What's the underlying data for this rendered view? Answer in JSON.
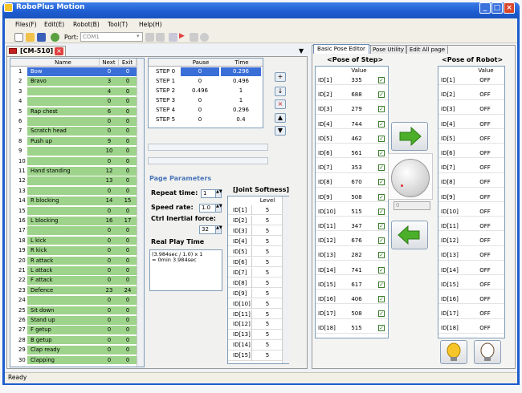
{
  "window": {
    "title": "RoboPlus Motion"
  },
  "menu": [
    "Files(F)",
    "Edit(E)",
    "Robot(B)",
    "Tool(T)",
    "Help(H)"
  ],
  "toolbar": {
    "port_label": "Port:",
    "port_value": "COM1"
  },
  "doc_tab": {
    "label": "[CM-510]"
  },
  "motion_list": {
    "headers": {
      "name": "Name",
      "next": "Next",
      "exit": "Exit"
    },
    "rows": [
      {
        "idx": "1",
        "name": "Bow",
        "next": "0",
        "exit": "0",
        "selected": true
      },
      {
        "idx": "2",
        "name": "Bravo",
        "next": "3",
        "exit": "0"
      },
      {
        "idx": "3",
        "name": "",
        "next": "4",
        "exit": "0"
      },
      {
        "idx": "4",
        "name": "",
        "next": "0",
        "exit": "0"
      },
      {
        "idx": "5",
        "name": "Rap chest",
        "next": "6",
        "exit": "0"
      },
      {
        "idx": "6",
        "name": "",
        "next": "0",
        "exit": "0"
      },
      {
        "idx": "7",
        "name": "Scratch head",
        "next": "0",
        "exit": "0"
      },
      {
        "idx": "8",
        "name": "Push up",
        "next": "9",
        "exit": "0"
      },
      {
        "idx": "9",
        "name": "",
        "next": "10",
        "exit": "0"
      },
      {
        "idx": "10",
        "name": "",
        "next": "0",
        "exit": "0"
      },
      {
        "idx": "11",
        "name": "Hand standing",
        "next": "12",
        "exit": "0"
      },
      {
        "idx": "12",
        "name": "",
        "next": "13",
        "exit": "0"
      },
      {
        "idx": "13",
        "name": "",
        "next": "0",
        "exit": "0"
      },
      {
        "idx": "14",
        "name": "R blocking",
        "next": "14",
        "exit": "15"
      },
      {
        "idx": "15",
        "name": "",
        "next": "0",
        "exit": "0"
      },
      {
        "idx": "16",
        "name": "L blocking",
        "next": "16",
        "exit": "17"
      },
      {
        "idx": "17",
        "name": "",
        "next": "0",
        "exit": "0"
      },
      {
        "idx": "18",
        "name": "L kick",
        "next": "0",
        "exit": "0"
      },
      {
        "idx": "19",
        "name": "R kick",
        "next": "0",
        "exit": "0"
      },
      {
        "idx": "20",
        "name": "R attack",
        "next": "0",
        "exit": "0"
      },
      {
        "idx": "21",
        "name": "L attack",
        "next": "0",
        "exit": "0"
      },
      {
        "idx": "22",
        "name": "F attack",
        "next": "0",
        "exit": "0"
      },
      {
        "idx": "23",
        "name": "Defence",
        "next": "23",
        "exit": "24"
      },
      {
        "idx": "24",
        "name": "",
        "next": "0",
        "exit": "0"
      },
      {
        "idx": "25",
        "name": "Sit down",
        "next": "0",
        "exit": "0"
      },
      {
        "idx": "26",
        "name": "Stand up",
        "next": "0",
        "exit": "0"
      },
      {
        "idx": "27",
        "name": "F getup",
        "next": "0",
        "exit": "0"
      },
      {
        "idx": "28",
        "name": "B getup",
        "next": "0",
        "exit": "0"
      },
      {
        "idx": "29",
        "name": "Clap ready",
        "next": "0",
        "exit": "0"
      },
      {
        "idx": "30",
        "name": "Clapping",
        "next": "0",
        "exit": "0"
      }
    ]
  },
  "steps": {
    "headers": {
      "pause": "Pause",
      "time": "Time"
    },
    "rows": [
      {
        "name": "STEP 0",
        "pause": "0",
        "time": "0.296",
        "selected": true
      },
      {
        "name": "STEP 1",
        "pause": "0",
        "time": "0.496"
      },
      {
        "name": "STEP 2",
        "pause": "0.496",
        "time": "1"
      },
      {
        "name": "STEP 3",
        "pause": "0",
        "time": "1"
      },
      {
        "name": "STEP 4",
        "pause": "0",
        "time": "0.296"
      },
      {
        "name": "STEP 5",
        "pause": "0",
        "time": "0.4"
      }
    ]
  },
  "params": {
    "title": "Page Parameters",
    "repeat_label": "Repeat time:",
    "repeat_value": "1",
    "speed_label": "Speed rate:",
    "speed_value": "1.0",
    "inertial_label": "Ctrl Inertial force:",
    "inertial_value": "32",
    "realplay_label": "Real Play Time",
    "realplay_line1": "(3.984sec / 1.0) x 1",
    "realplay_line2": "= 0min 3.984sec"
  },
  "softness": {
    "title": "[Joint Softness]",
    "header": "Level",
    "rows": [
      {
        "id": "ID[1]",
        "level": "5"
      },
      {
        "id": "ID[2]",
        "level": "5"
      },
      {
        "id": "ID[3]",
        "level": "5"
      },
      {
        "id": "ID[4]",
        "level": "5"
      },
      {
        "id": "ID[5]",
        "level": "5"
      },
      {
        "id": "ID[6]",
        "level": "5"
      },
      {
        "id": "ID[7]",
        "level": "5"
      },
      {
        "id": "ID[8]",
        "level": "5"
      },
      {
        "id": "ID[9]",
        "level": "5"
      },
      {
        "id": "ID[10]",
        "level": "5"
      },
      {
        "id": "ID[11]",
        "level": "5"
      },
      {
        "id": "ID[12]",
        "level": "5"
      },
      {
        "id": "ID[13]",
        "level": "5"
      },
      {
        "id": "ID[14]",
        "level": "5"
      },
      {
        "id": "ID[15]",
        "level": "5"
      }
    ]
  },
  "tabs": [
    "Basic Pose Editor",
    "Pose Utility",
    "Edit All page"
  ],
  "pose_step": {
    "title": "<Pose of Step>",
    "header": "Value",
    "rows": [
      {
        "id": "ID[1]",
        "value": "335"
      },
      {
        "id": "ID[2]",
        "value": "688"
      },
      {
        "id": "ID[3]",
        "value": "279"
      },
      {
        "id": "ID[4]",
        "value": "744"
      },
      {
        "id": "ID[5]",
        "value": "462"
      },
      {
        "id": "ID[6]",
        "value": "561"
      },
      {
        "id": "ID[7]",
        "value": "353"
      },
      {
        "id": "ID[8]",
        "value": "670"
      },
      {
        "id": "ID[9]",
        "value": "508"
      },
      {
        "id": "ID[10]",
        "value": "515"
      },
      {
        "id": "ID[11]",
        "value": "347"
      },
      {
        "id": "ID[12]",
        "value": "676"
      },
      {
        "id": "ID[13]",
        "value": "282"
      },
      {
        "id": "ID[14]",
        "value": "741"
      },
      {
        "id": "ID[15]",
        "value": "617"
      },
      {
        "id": "ID[16]",
        "value": "406"
      },
      {
        "id": "ID[17]",
        "value": "508"
      },
      {
        "id": "ID[18]",
        "value": "515"
      }
    ]
  },
  "pose_robot": {
    "title": "<Pose of Robot>",
    "header": "Value",
    "rows": [
      {
        "id": "ID[1]",
        "value": "OFF"
      },
      {
        "id": "ID[2]",
        "value": "OFF"
      },
      {
        "id": "ID[3]",
        "value": "OFF"
      },
      {
        "id": "ID[4]",
        "value": "OFF"
      },
      {
        "id": "ID[5]",
        "value": "OFF"
      },
      {
        "id": "ID[6]",
        "value": "OFF"
      },
      {
        "id": "ID[7]",
        "value": "OFF"
      },
      {
        "id": "ID[8]",
        "value": "OFF"
      },
      {
        "id": "ID[9]",
        "value": "OFF"
      },
      {
        "id": "ID[10]",
        "value": "OFF"
      },
      {
        "id": "ID[11]",
        "value": "OFF"
      },
      {
        "id": "ID[12]",
        "value": "OFF"
      },
      {
        "id": "ID[13]",
        "value": "OFF"
      },
      {
        "id": "ID[14]",
        "value": "OFF"
      },
      {
        "id": "ID[15]",
        "value": "OFF"
      },
      {
        "id": "ID[16]",
        "value": "OFF"
      },
      {
        "id": "ID[17]",
        "value": "OFF"
      },
      {
        "id": "ID[18]",
        "value": "OFF"
      }
    ]
  },
  "dial_value": "0",
  "status": "Ready",
  "colors": {
    "green_row": "#9dd38a",
    "selected": "#3a6fd8",
    "title_blue": "#1d5cd0",
    "arrow_green": "#4caf2a"
  }
}
